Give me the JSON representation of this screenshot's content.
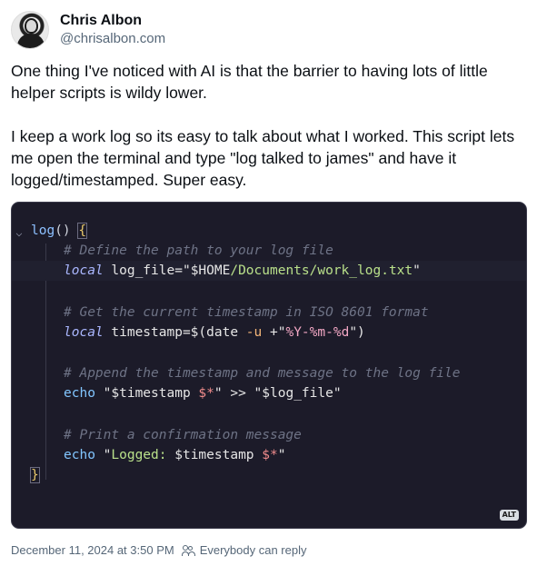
{
  "author": {
    "display_name": "Chris Albon",
    "handle": "@chrisalbon.com",
    "avatar_icon": "avatar"
  },
  "post": {
    "text": "One thing I've noticed with AI is that the barrier to having lots of little helper scripts is wildy lower.\n\nI keep a work log so its easy to talk about what I worked. This script lets me open the terminal and type \"log talked to james\" and have it logged/timestamped. Super easy."
  },
  "code_image": {
    "alt_badge": "ALT",
    "lines": {
      "l1_fn": "log",
      "l1_paren": "() ",
      "l1_brace": "{",
      "l2": "# Define the path to your log file",
      "l3_kw": "local",
      "l3_var": " log_file=\"",
      "l3_home": "$HOME",
      "l3_path": "/Documents/work_log.txt",
      "l3_end": "\"",
      "l5": "# Get the current timestamp in ISO 8601 format",
      "l6_kw": "local",
      "l6_var": " timestamp=$(date ",
      "l6_flag": "-u",
      "l6_plus": " +\"",
      "l6_fmt": "%Y-%m-%d",
      "l6_end": "\")",
      "l8": "# Append the timestamp and message to the log file",
      "l9_echo": "echo",
      "l9_a": " \"$timestamp ",
      "l9_star": "$*",
      "l9_b": "\" >> \"$log_file\"",
      "l11": "# Print a confirmation message",
      "l12_echo": "echo",
      "l12_a": " \"",
      "l12_logged": "Logged: ",
      "l12_ts": "$timestamp ",
      "l12_star": "$*",
      "l12_end": "\"",
      "l13_brace": "}"
    }
  },
  "footer": {
    "timestamp": "December 11, 2024 at 3:50 PM",
    "reply_setting": "Everybody can reply"
  }
}
